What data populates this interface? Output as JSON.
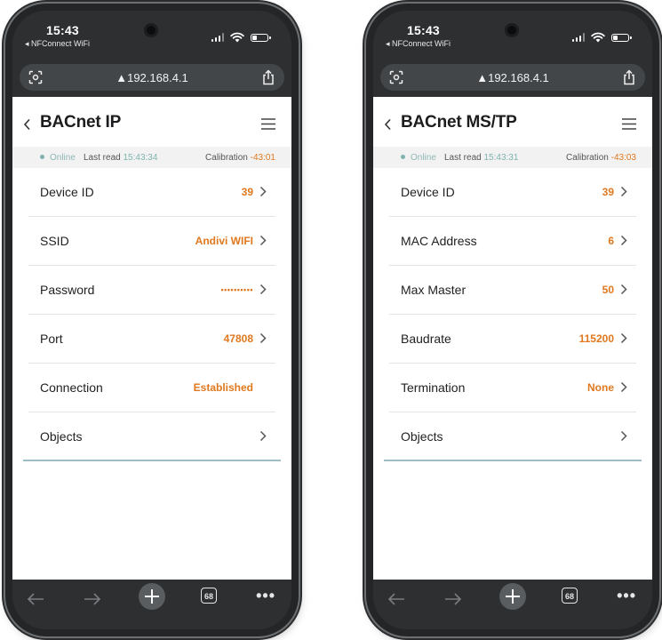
{
  "phones": {
    "left": {
      "status": {
        "time": "15:43",
        "back_app": "◂ NFConnect WiFi"
      },
      "browser": {
        "url": "▲192.168.4.1",
        "tab_count": "68"
      },
      "title": "BACnet IP",
      "info": {
        "online": "Online",
        "last_read_label": "Last read",
        "last_read_time": "15:43:34",
        "calibration_label": "Calibration",
        "calibration_value": "-43:01"
      },
      "rows": [
        {
          "label": "Device ID",
          "value": "39"
        },
        {
          "label": "SSID",
          "value": "Andivi WIFI"
        },
        {
          "label": "Password",
          "value": "••••••••••"
        },
        {
          "label": "Port",
          "value": "47808"
        },
        {
          "label": "Connection",
          "value": "Established"
        },
        {
          "label": "Objects",
          "value": ""
        }
      ]
    },
    "right": {
      "status": {
        "time": "15:43",
        "back_app": "◂ NFConnect WiFi"
      },
      "browser": {
        "url": "▲192.168.4.1",
        "tab_count": "68"
      },
      "title": "BACnet MS/TP",
      "info": {
        "online": "Online",
        "last_read_label": "Last read",
        "last_read_time": "15:43:31",
        "calibration_label": "Calibration",
        "calibration_value": "-43:03"
      },
      "rows": [
        {
          "label": "Device ID",
          "value": "39"
        },
        {
          "label": "MAC Address",
          "value": "6"
        },
        {
          "label": "Max Master",
          "value": "50"
        },
        {
          "label": "Baudrate",
          "value": "115200"
        },
        {
          "label": "Termination",
          "value": "None"
        },
        {
          "label": "Objects",
          "value": ""
        }
      ]
    }
  },
  "colors": {
    "accent": "#e0781f",
    "online": "#7fb3ad",
    "divider_accent": "#9dbec9"
  },
  "icons": [
    "back-chevron-icon",
    "menu-icon",
    "chevron-right-icon",
    "scan-icon",
    "share-icon",
    "arrow-left-icon",
    "arrow-right-icon",
    "plus-icon",
    "tabs-icon",
    "more-icon",
    "wifi-icon",
    "signal-icon",
    "battery-icon"
  ]
}
